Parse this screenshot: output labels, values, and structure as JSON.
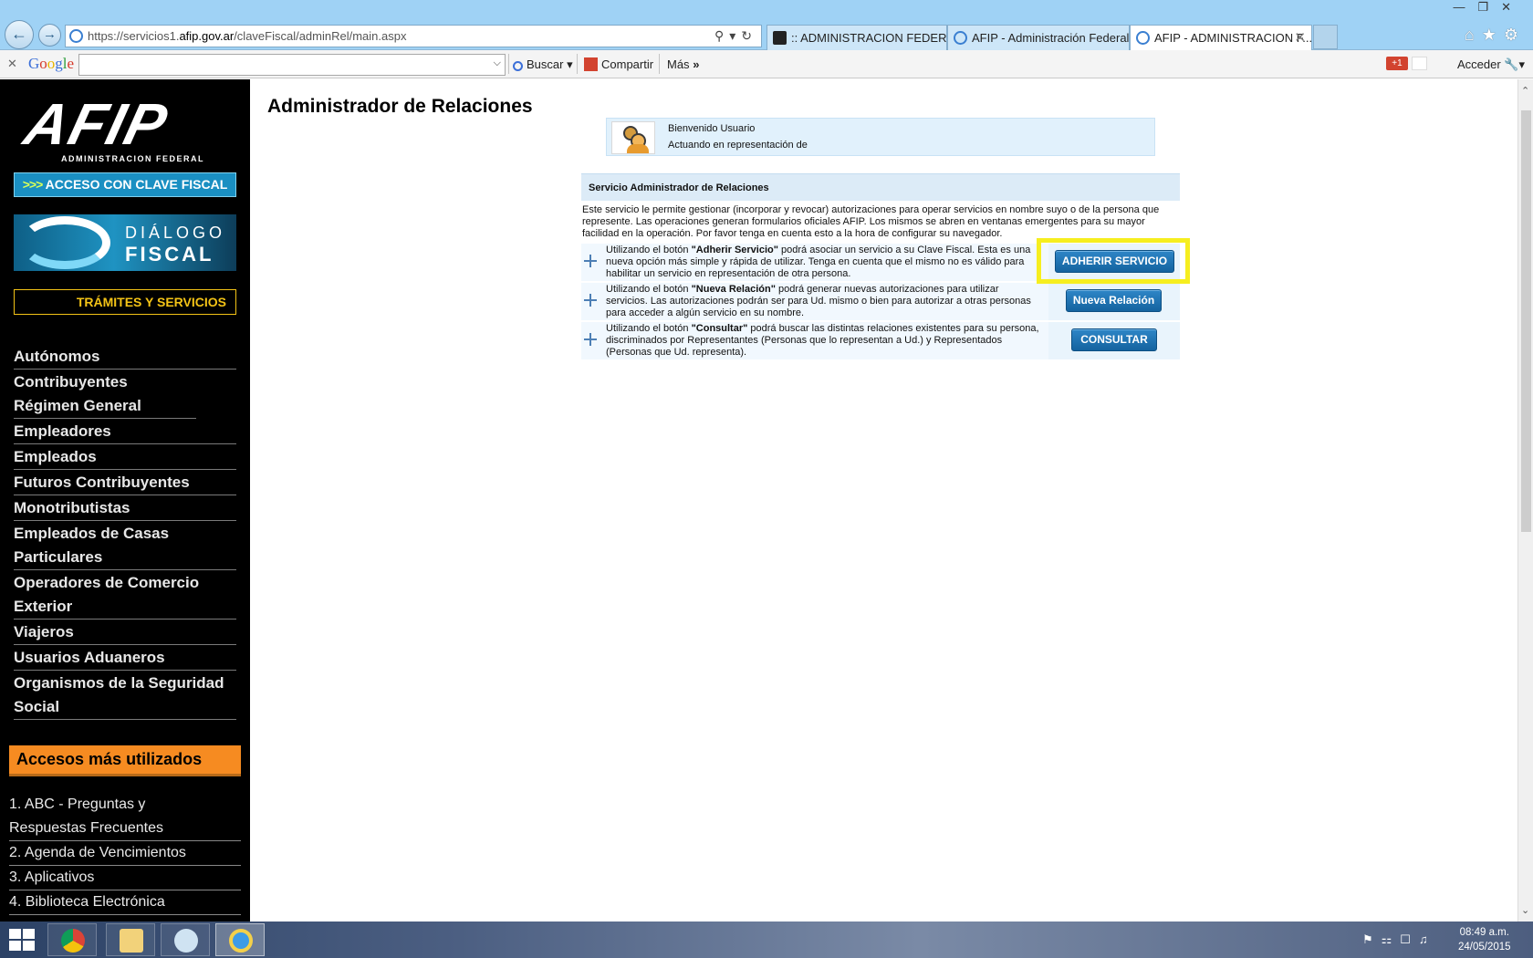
{
  "browser": {
    "url_prefix": "https://servicios1.",
    "url_domain": "afip.gov.ar",
    "url_path": "/claveFiscal/adminRel/main.aspx",
    "tabs": [
      {
        "label": ":: ADMINISTRACION FEDERAL ..."
      },
      {
        "label": "AFIP - Administración Federal"
      },
      {
        "label": "AFIP - ADMINISTRACION F..."
      }
    ]
  },
  "google_toolbar": {
    "logo": "Google",
    "search_value": "",
    "buscar_label": "Buscar",
    "compartir_label": "Compartir",
    "mas_label": "Más",
    "gplus_label": "+1",
    "acceder_label": "Acceder"
  },
  "sidebar": {
    "logo_letters": "AFIP",
    "logo_subtitle": "ADMINISTRACION FEDERAL",
    "clave_fiscal_arrows": ">>>",
    "clave_fiscal_label": "ACCESO CON CLAVE FISCAL",
    "dialogo_line1": "DIÁLOGO",
    "dialogo_line2": "FISCAL",
    "tramites_label": "TRÁMITES Y SERVICIOS",
    "nav_items": [
      {
        "label": "Autónomos"
      },
      {
        "label": "Contribuyentes Régimen General"
      },
      {
        "label": "Empleadores"
      },
      {
        "label": "Empleados"
      },
      {
        "label": "Futuros Contribuyentes"
      },
      {
        "label": "Monotributistas"
      },
      {
        "label": "Empleados de Casas Particulares"
      },
      {
        "label": "Operadores de Comercio Exterior"
      },
      {
        "label": "Viajeros"
      },
      {
        "label": "Usuarios Aduaneros"
      },
      {
        "label": "Organismos de la Seguridad Social"
      }
    ],
    "accesos_title": "Accesos más utilizados",
    "accesos_items": [
      {
        "label": "1. ABC - Preguntas y Respuestas Frecuentes"
      },
      {
        "label": "2. Agenda de Vencimientos"
      },
      {
        "label": "3. Aplicativos"
      },
      {
        "label": "4. Biblioteca Electrónica"
      }
    ]
  },
  "main": {
    "page_title": "Administrador de Relaciones",
    "welcome_line1": "Bienvenido Usuario",
    "welcome_line2": "Actuando en representación de",
    "service_header": "Servicio Administrador de Relaciones",
    "service_intro": "Este servicio le permite gestionar (incorporar y revocar) autorizaciones para operar servicios en nombre suyo o de la persona que represente. Las operaciones generan formularios oficiales AFIP. Los mismos se abren en ventanas emergentes para su mayor facilidad en la operación. Por favor tenga en cuenta esto a la hora de configurar su navegador.",
    "rows": [
      {
        "pre": "Utilizando el botón ",
        "bold": "\"Adherir Servicio\"",
        "post": " podrá asociar un servicio a su Clave Fiscal. Esta es una nueva opción más simple y rápida de utilizar. Tenga en cuenta que el mismo no es válido para habilitar un servicio en representación de otra persona.",
        "button": "ADHERIR SERVICIO"
      },
      {
        "pre": "Utilizando el botón ",
        "bold": "\"Nueva Relación\"",
        "post": " podrá generar nuevas autorizaciones para utilizar servicios. Las autorizaciones podrán ser para Ud. mismo o bien para autorizar a otras personas para acceder a algún servicio en su nombre.",
        "button": "Nueva Relación"
      },
      {
        "pre": "Utilizando el botón ",
        "bold": "\"Consultar\"",
        "post": " podrá buscar las distintas relaciones existentes para su persona, discriminados por Representantes (Personas que lo representan a Ud.) y Representados (Personas que Ud. representa).",
        "button": "CONSULTAR"
      }
    ]
  },
  "taskbar": {
    "time": "08:49 a.m.",
    "date": "24/05/2015"
  },
  "colors": {
    "highlight": "#f6ee1f",
    "button_blue": "#1e72b3",
    "accesos_orange": "#f68b21",
    "tramites_yellow": "#f3c316"
  }
}
